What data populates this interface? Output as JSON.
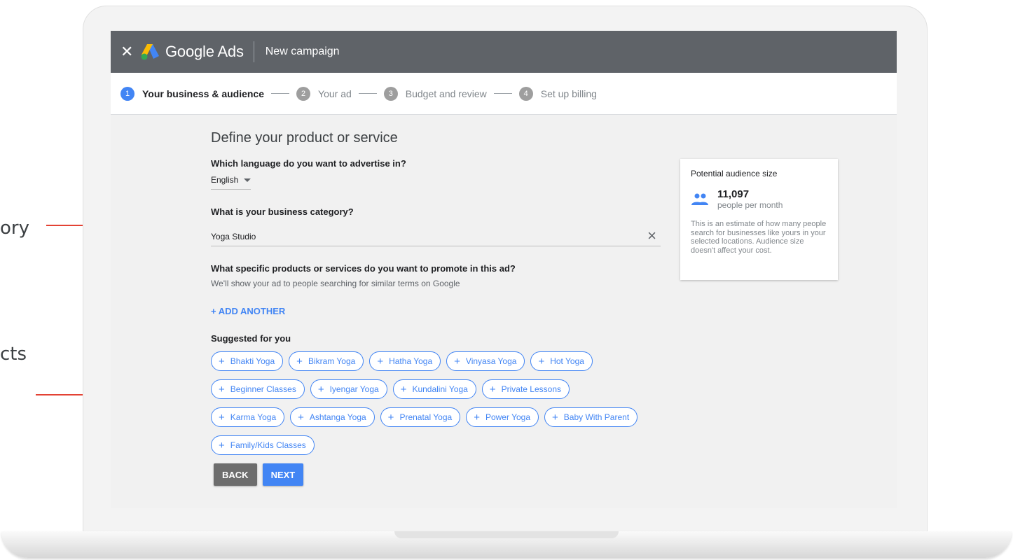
{
  "callouts": {
    "top_text": "ory",
    "bottom_text": "cts"
  },
  "header": {
    "close_icon": "close-icon",
    "brand": "Google Ads",
    "campaign_title": "New campaign"
  },
  "stepper": {
    "steps": [
      {
        "num": "1",
        "label": "Your business & audience",
        "active": true
      },
      {
        "num": "2",
        "label": "Your ad",
        "active": false
      },
      {
        "num": "3",
        "label": "Budget and review",
        "active": false
      },
      {
        "num": "4",
        "label": "Set up billing",
        "active": false
      }
    ]
  },
  "form": {
    "heading": "Define your product or service",
    "language_question": "Which language do you want to advertise in?",
    "language_value": "English",
    "category_question": "What is your business category?",
    "category_value": "Yoga Studio",
    "products_question": "What specific products or services do you want to promote in this ad?",
    "products_helper": "We'll show your ad to people searching for similar terms on Google",
    "add_another": "+ ADD ANOTHER",
    "suggested_label": "Suggested for you",
    "chip_rows": [
      [
        "Bhakti Yoga",
        "Bikram Yoga",
        "Hatha Yoga",
        "Vinyasa Yoga",
        "Hot Yoga"
      ],
      [
        "Beginner Classes",
        "Iyengar Yoga",
        "Kundalini Yoga",
        "Private Lessons"
      ],
      [
        "Karma Yoga",
        "Ashtanga Yoga",
        "Prenatal Yoga",
        "Power Yoga",
        "Baby With Parent"
      ],
      [
        "Family/Kids Classes"
      ]
    ],
    "back_label": "BACK",
    "next_label": "NEXT"
  },
  "audience_card": {
    "title": "Potential audience size",
    "count": "11,097",
    "unit": "people per month",
    "description": "This is an estimate of how many people search for businesses like yours in your selected locations. Audience size doesn't affect your cost."
  },
  "colors": {
    "accent": "#4285f4",
    "header_bg": "#5f6368",
    "callout_line": "#e34234"
  }
}
